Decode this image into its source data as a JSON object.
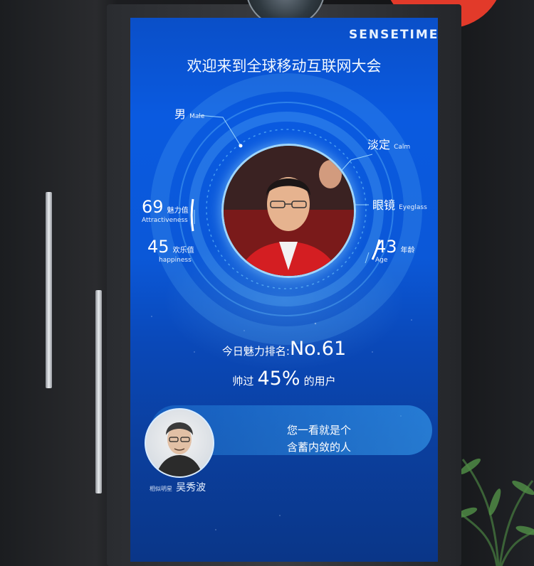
{
  "brand": "SENSETIME",
  "welcome": "欢迎来到全球移动互联网大会",
  "attributes": {
    "gender": {
      "zh": "男",
      "en": "Male"
    },
    "mood": {
      "zh": "淡定",
      "en": "Calm"
    },
    "eyewear": {
      "zh": "眼镜",
      "en": "Eyeglass"
    },
    "attractiveness": {
      "value": "69",
      "zh": "魅力值",
      "en": "Attractiveness"
    },
    "happiness": {
      "value": "45",
      "zh": "欢乐值",
      "en": "happiness"
    },
    "age": {
      "value": "43",
      "zh": "年龄",
      "en": "Age"
    }
  },
  "ranking": {
    "label": "今日魅力排名:",
    "value": "No.61"
  },
  "beat": {
    "prefix": "帅过",
    "value": "45%",
    "suffix": "的用户"
  },
  "match": {
    "quote_line1": "您一看就是个",
    "quote_line2": "含蓄内敛的人",
    "tag": "相似明星",
    "name": "吴秀波"
  },
  "colors": {
    "screen": "#0a55d8",
    "ring": "#6ec8ff",
    "text": "#ffffff",
    "sign": "#e23a2a"
  }
}
